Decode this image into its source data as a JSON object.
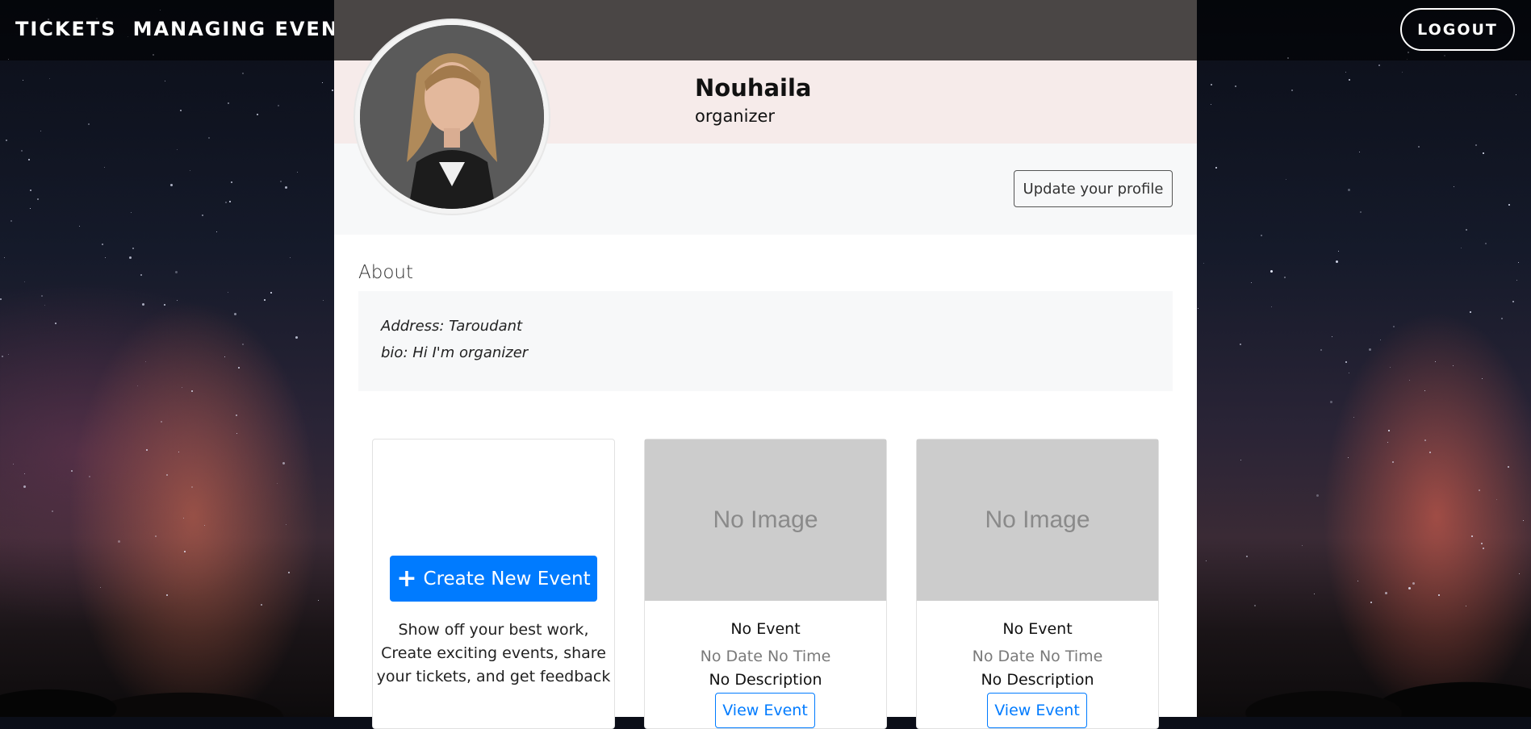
{
  "nav": {
    "brand_1": "TICKETS",
    "brand_2": "MANAGING EVENTS",
    "logout": "LOGOUT"
  },
  "profile": {
    "name": "Nouhaila",
    "role": "organizer",
    "update_button": "Update your profile"
  },
  "about": {
    "title": "About",
    "address": "Address: Taroudant",
    "bio": "bio: Hi I'm organizer"
  },
  "create_card": {
    "button": "Create New Event",
    "description": "Show off your best work, Create exciting events, share your tickets, and get feedback"
  },
  "events": [
    {
      "image": "No Image",
      "title": "No Event",
      "datetime": "No Date No Time",
      "description": "No Description",
      "button": "View Event"
    },
    {
      "image": "No Image",
      "title": "No Event",
      "datetime": "No Date No Time",
      "description": "No Description",
      "button": "View Event"
    }
  ],
  "colors": {
    "primary": "#007bff",
    "hero_bg": "#f6ebea",
    "navbar_center": "#4a4645"
  }
}
